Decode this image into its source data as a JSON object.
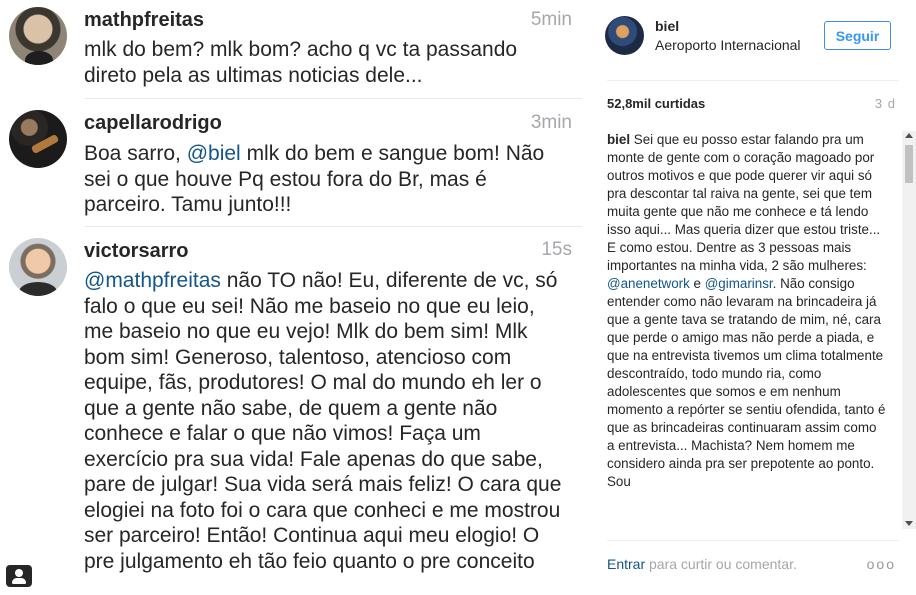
{
  "comments": [
    {
      "username": "mathpfreitas",
      "time": "5min",
      "text": "mlk do bem? mlk bom? acho q vc ta passando direto pela as ultimas noticias dele..."
    },
    {
      "username": "capellarodrigo",
      "time": "3min",
      "text_pre": "Boa sarro, ",
      "mention": "@biel",
      "text_post": " mlk do bem e sangue bom! Não sei o que houve Pq estou fora do Br, mas é parceiro. Tamu junto!!!"
    },
    {
      "username": "victorsarro",
      "time": "15s",
      "mention": "@mathpfreitas",
      "text_post": " não TO não! Eu, diferente de vc, só falo o que eu sei! Não me baseio no que eu leio, me baseio no que eu vejo! Mlk do bem sim! Mlk bom sim! Generoso, talentoso, atencioso com equipe, fãs, produtores! O mal do mundo eh ler o que a gente não sabe, de quem a gente não conhece e falar o que não vimos! Faça um exercício pra sua vida! Fale apenas do que sabe, pare de julgar! Sua vida será mais feliz! O cara que elogiei na foto foi o cara que conheci e me mostrou ser parceiro! Então! Continua aqui meu elogio! O pre julgamento eh tão feio quanto o pre conceito"
    }
  ],
  "post": {
    "username": "biel",
    "location": "Aeroporto Internacional",
    "follow_label": "Seguir",
    "likes": "52,8mil curtidas",
    "ago": "3 d",
    "caption_user": "biel",
    "caption_1": " Sei que eu posso estar falando pra um monte de gente com o coração magoado por outros motivos e que pode querer vir aqui só pra descontar tal raiva na gente, sei que tem muita gente que não me conhece e tá lendo isso aqui... Mas queria dizer que estou triste... E como estou. Dentre as 3 pessoas mais importantes na minha vida, 2 são mulheres: ",
    "caption_mention_1": "@anenetwork",
    "caption_and": " e ",
    "caption_mention_2": "@gimarinsr",
    "caption_2": ". Não consigo entender como não levaram na brincadeira já que a gente tava se tratando de mim, né, cara que perde o amigo mas não perde a piada, e que na entrevista tivemos um clima totalmente descontraído, todo mundo ria, como adolescentes que somos e em nenhum momento a repórter se sentiu ofendida, tanto é que as brincadeiras continuaram assim como a entrevista... Machista? Nem homem me considero ainda pra ser prepotente ao ponto. Sou",
    "enter_label": "Entrar",
    "comment_prompt": " para curtir ou comentar.",
    "more_label": "ooo"
  },
  "icons": {
    "profile_corner": "user-icon",
    "more": "more-options-icon"
  },
  "colors": {
    "link": "#125688",
    "follow_blue": "#3897f0",
    "muted": "#a5a7aa"
  }
}
